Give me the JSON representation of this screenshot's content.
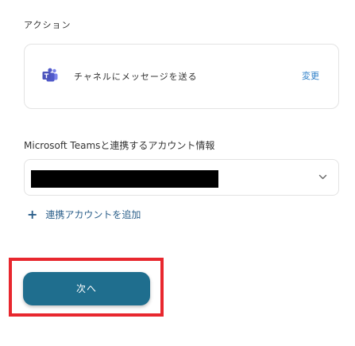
{
  "action_section": {
    "label": "アクション",
    "action_name": "チャネルにメッセージを送る",
    "change_link": "変更",
    "icon": "microsoft-teams-icon"
  },
  "teams_account": {
    "label": "Microsoft Teamsと連携するアカウント情報",
    "selected_account": "",
    "add_account_label": "連携アカウントを追加",
    "add_icon": "plus-icon",
    "chevron_icon": "chevron-down-icon"
  },
  "footer": {
    "next_button_label": "次へ"
  },
  "colors": {
    "link": "#2d7fc8",
    "primary_button": "#1f6e8e",
    "highlight_frame": "#e8272e"
  }
}
